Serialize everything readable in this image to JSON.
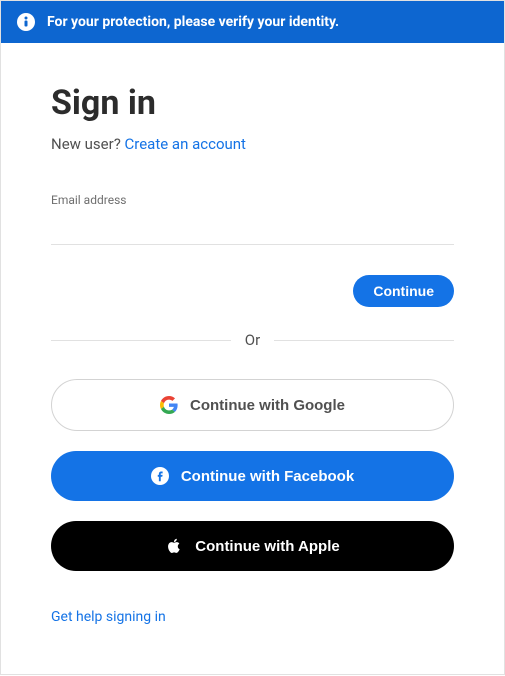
{
  "banner": {
    "message": "For your protection, please verify your identity."
  },
  "signin": {
    "title": "Sign in",
    "new_user_text": "New user? ",
    "create_account_link": "Create an account",
    "email_label": "Email address",
    "email_value": "",
    "continue_label": "Continue",
    "divider_label": "Or",
    "google_label": "Continue with Google",
    "facebook_label": "Continue with Facebook",
    "apple_label": "Continue with Apple",
    "help_link": "Get help signing in"
  }
}
